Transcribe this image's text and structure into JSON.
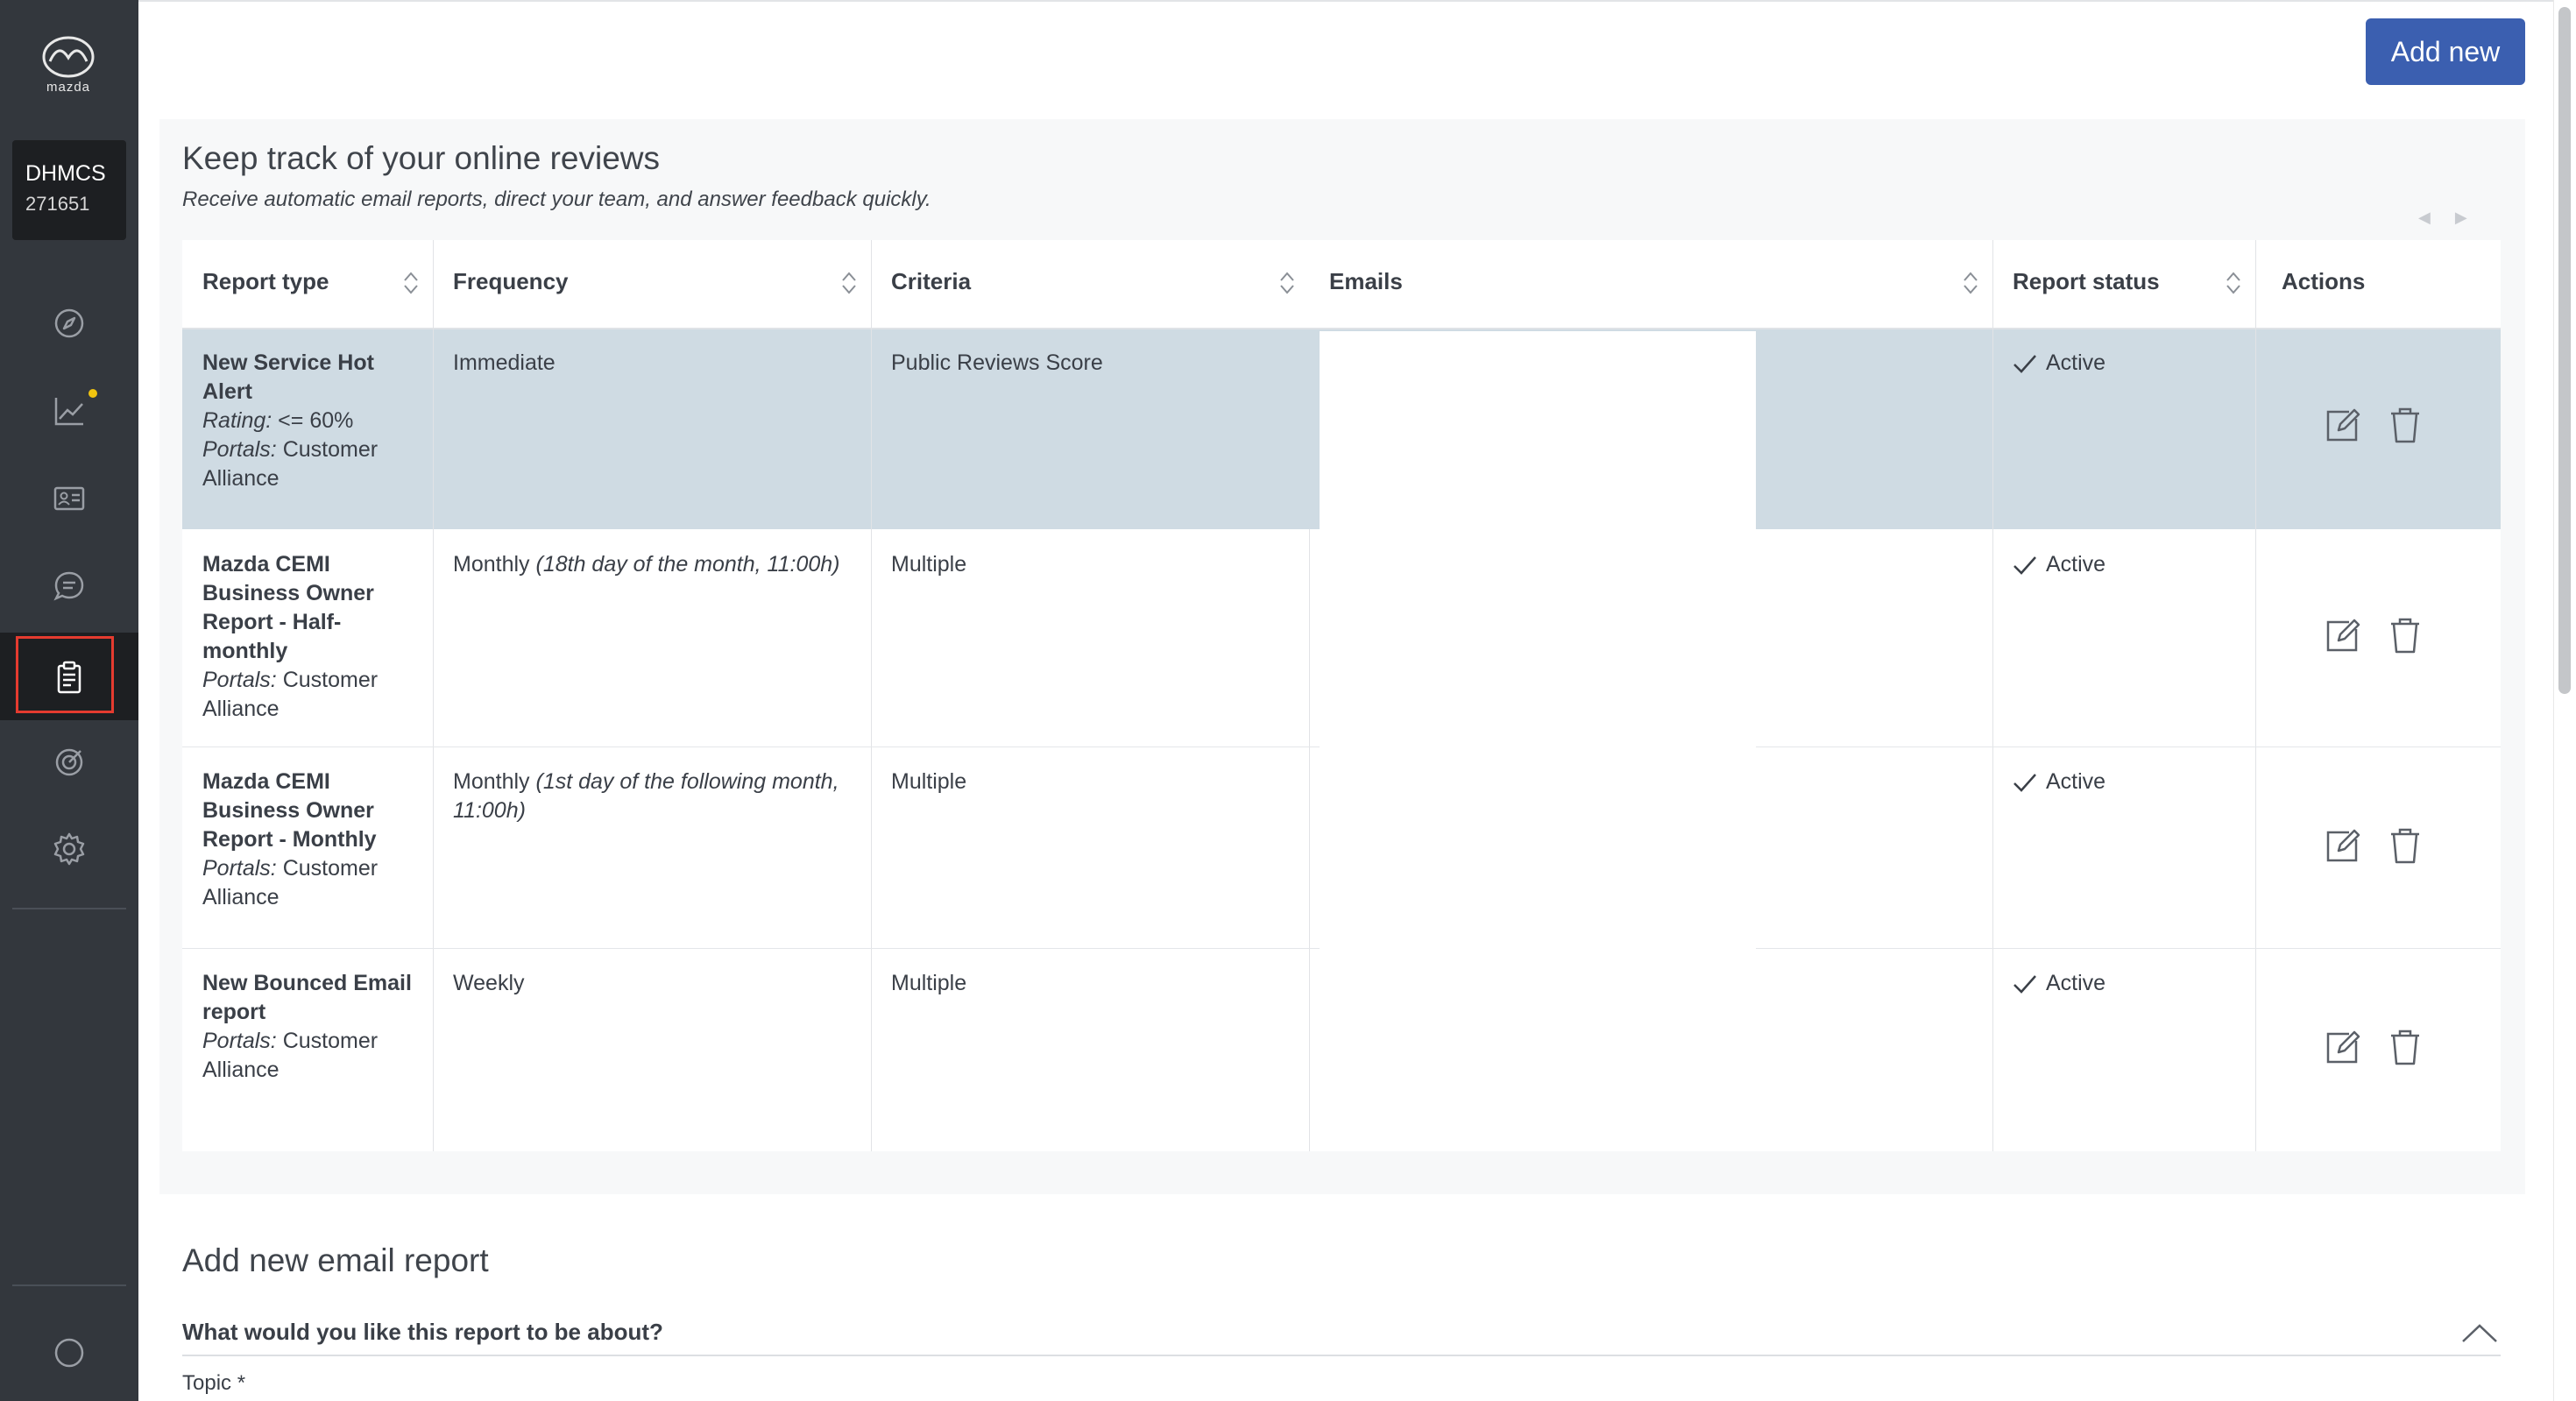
{
  "sidebar": {
    "logo_text": "mazda",
    "account_name": "DHMCS",
    "account_number": "271651",
    "nav_items": [
      "compass-icon",
      "chart-icon",
      "id-card-icon",
      "chat-icon",
      "clipboard-icon",
      "target-icon",
      "gear-icon"
    ],
    "active_item": "clipboard-icon"
  },
  "header": {
    "add_new_label": "Add new"
  },
  "panel": {
    "title": "Keep track of your online reviews",
    "subtitle": "Receive automatic email reports, direct your team, and answer feedback quickly."
  },
  "table": {
    "columns": [
      "Report type",
      "Frequency",
      "Criteria",
      "Emails",
      "Report status",
      "Actions"
    ],
    "rows": [
      {
        "name": "New Service Hot Alert",
        "rating_label": "Rating:",
        "rating_value": "<= 60%",
        "portals_label": "Portals:",
        "portals_value": "Customer Alliance",
        "frequency": "Immediate",
        "frequency_detail": "",
        "criteria": "Public Reviews Score",
        "status": "Active"
      },
      {
        "name": "Mazda CEMI Business Owner Report - Half-monthly",
        "portals_label": "Portals:",
        "portals_value": "Customer Alliance",
        "frequency": "Monthly",
        "frequency_detail": "(18th day of the month, 11:00h)",
        "criteria": "Multiple",
        "status": "Active"
      },
      {
        "name": "Mazda CEMI Business Owner Report - Monthly",
        "portals_label": "Portals:",
        "portals_value": "Customer Alliance",
        "frequency": "Monthly",
        "frequency_detail": "(1st day of the following month, 11:00h)",
        "criteria": "Multiple",
        "status": "Active"
      },
      {
        "name": "New Bounced Email report",
        "portals_label": "Portals:",
        "portals_value": "Customer Alliance",
        "frequency": "Weekly",
        "frequency_detail": "",
        "criteria": "Multiple",
        "status": "Active"
      }
    ]
  },
  "add_report": {
    "title": "Add new email report",
    "question": "What would you like this report to be about?",
    "topic_label": "Topic *"
  },
  "colors": {
    "sidebar_bg": "#33373d",
    "active_bg": "#1d1f22",
    "button_blue": "#3b5fb0",
    "highlight_row": "#cfdbe3",
    "active_outline": "#e53b2f",
    "notification_dot": "#f1c40f"
  }
}
